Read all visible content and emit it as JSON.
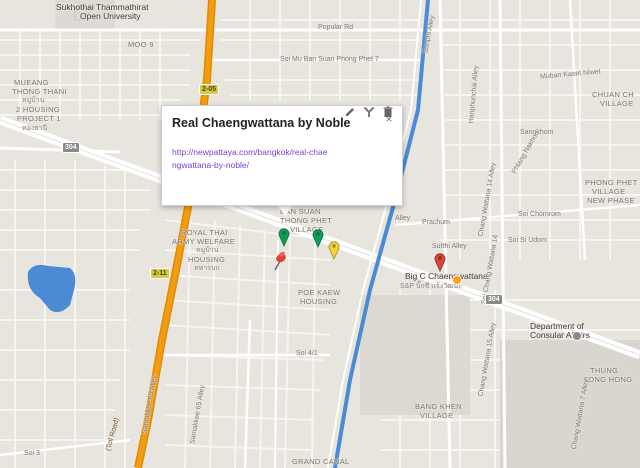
{
  "popup": {
    "title": "Real Chaengwattana by Noble",
    "link": "http://newpattaya.com/bangkok/real-chaengwattana-by-noble/",
    "close_glyph": "×",
    "tools": [
      "pencil-icon",
      "style-icon",
      "trash-icon"
    ]
  },
  "labels": {
    "university": "Sukhothai Thammathirat",
    "university2": "Open University",
    "moo9": "MOO 9",
    "mueang1": "MUEANG",
    "mueang2": "THONG THANI",
    "mueang3": "2 HOUSING",
    "mueang4": "PROJECT 1",
    "royal1": "ROYAL THAI",
    "royal2": "ARMY WELFARE",
    "royal3": "HOUSING",
    "ban1": "BAN SUAN",
    "ban2": "THONG PHET",
    "ban3": "VILLAGE",
    "poe1": "POE KAEW",
    "poe2": "HOUSING",
    "phong1": "PHONG PHET",
    "phong2": "VILLAGE",
    "phong3": "NEW PHASE",
    "chuan1": "CHUAN CH",
    "chuan2": "VILLAGE",
    "bangkhen1": "BANG KHEN",
    "bangkhen2": "VILLAGE",
    "thungsong1": "THUNG",
    "thungsong2": "SONG HONG",
    "grandcanal": "GRAND CANAL",
    "bigc": "Big C Chaengwattana",
    "bigc_thai": "S&P บิ๊กซี แจ้งวัฒนะ",
    "dept1": "Department of",
    "dept2": "Consular Affairs",
    "popular_rd": "Popular Rd",
    "soi_mu_ban": "Soi Mu Ban Suan Phong Phet 7",
    "muban_kaset": "Muban Kaset Niwet",
    "sangkhom": "Sangkhom",
    "phlang_nakhon": "Phlang Nakhon",
    "prachum": "Prachum",
    "sutthi": "Sutthi Alley",
    "soi_chomrom": "Soi Chomrom",
    "soi_si_udom": "Soi Si Udom",
    "soi_4_1": "Soi 4/1",
    "soi_3": "Soi 3",
    "alley": "Alley",
    "samakkee65a": "Samakkee 65 Alley",
    "samakkee65b": "Samakkee 65 Alley",
    "sanphi": "Sanphi Alley",
    "hanphunchai": "Hanphunchai Alley",
    "chang14": "Chang Wattana 14 Alley",
    "soi_chang14": "Soi Chang Wattana 14",
    "chang15": "Chang Wattana 15 Alley",
    "chang7": "Chang Wattana 7 Alley",
    "tollroad": "(Toll Road)",
    "route304a": "304",
    "route304b": "304",
    "route2_05": "2-05",
    "route2_11": "2-11",
    "thai_a": "หมู่บ้าน",
    "thai_b": "ทองธานี",
    "thai_c": "หมู่บ้าน",
    "thai_d": "ทหารบก"
  },
  "markers": [
    {
      "name": "green-marker-1",
      "color": "#0f9d58"
    },
    {
      "name": "green-marker-2",
      "color": "#0f9d58"
    },
    {
      "name": "yellow-marker",
      "color": "#f4d03f"
    },
    {
      "name": "red-marker",
      "color": "#db4437"
    },
    {
      "name": "red-pushpin",
      "color": "#db4437"
    }
  ],
  "colors": {
    "map_bg": "#e8e4de",
    "major_road": "#ffffff",
    "tollway": "#f39c12",
    "canal": "#4b8bd6",
    "lake": "#4b8bd6",
    "grid": "#f7f5f1"
  }
}
